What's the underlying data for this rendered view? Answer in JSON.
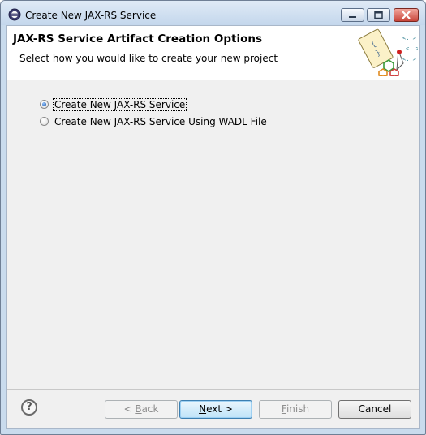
{
  "window": {
    "title": "Create New JAX-RS Service"
  },
  "banner": {
    "title": "JAX-RS Service Artifact Creation Options",
    "description": "Select how you would like to create your new project"
  },
  "options": [
    {
      "label": "Create New JAX-RS Service",
      "selected": true
    },
    {
      "label": "Create New JAX-RS Service Using WADL File",
      "selected": false
    }
  ],
  "buttons": {
    "help": "?",
    "back_mnemonic": "B",
    "back_rest": "ack",
    "back_prefix": "< ",
    "next_mnemonic": "N",
    "next_rest": "ext >",
    "finish_mnemonic": "F",
    "finish_rest": "inish",
    "cancel": "Cancel"
  },
  "colors": {
    "titlebar": "#c4d7ec",
    "client_background": "#f0f0f0",
    "close_button": "#c9463b"
  }
}
